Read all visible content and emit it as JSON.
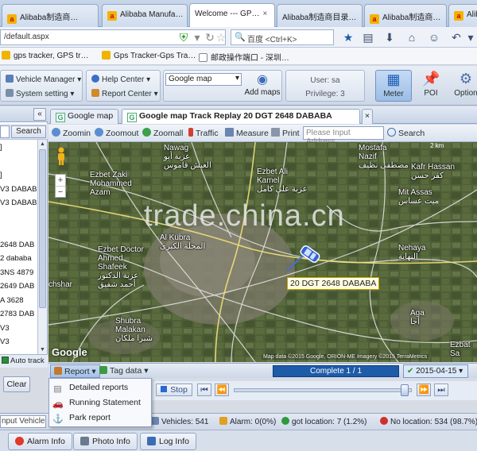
{
  "browser": {
    "tabs": [
      {
        "label": "Alibaba制造商…",
        "active": false
      },
      {
        "label": "Alibaba Manufa…",
        "active": false
      },
      {
        "label": "Welcome --- GP…",
        "active": true
      },
      {
        "label": "Alibaba制造商目录…",
        "active": false
      },
      {
        "label": "Alibaba制造商…",
        "active": false
      },
      {
        "label": "Alib",
        "active": false
      }
    ],
    "address": "/default.aspx",
    "search_engine": "百度",
    "search_hint": "<Ctrl+K>",
    "bookmarks": [
      "gps tracker, GPS tr…",
      "Gps Tracker-Gps Tra…",
      "邮政操作端口 - 深圳…"
    ]
  },
  "toolbar": {
    "vehicle_manager": "Vehicle Manager",
    "system_setting": "System setting",
    "help_center": "Help Center",
    "report_center": "Report Center",
    "map_type": "Google map",
    "add_maps": "Add maps",
    "user": "User: sa",
    "privilege": "Privilege: 3",
    "meter": "Meter",
    "poi": "POI",
    "option": "Option"
  },
  "left_panel": {
    "search_label": "Search",
    "vehicles": [
      "]",
      "",
      "]",
      "V3 DABAB",
      "V3 DABAB",
      "",
      "",
      "2648 DAB",
      "2 dababa",
      "3NS 4879",
      "2649 DAB",
      "A 3628",
      "2783 DAB",
      "V3",
      "V3"
    ],
    "auto_track": "Auto track",
    "clear": "Clear"
  },
  "map_tabs": [
    {
      "label": "Google map",
      "active": false
    },
    {
      "label": "Google map Track Replay 20 DGT 2648 DABABA",
      "active": true
    }
  ],
  "map_toolbar": {
    "zoom_in": "Zoomin",
    "zoom_out": "Zoomout",
    "zoom_all": "Zoomall",
    "traffic": "Traffic",
    "measure": "Measure",
    "print": "Print",
    "address_placeholder": "Please Input Address",
    "search": "Search"
  },
  "map": {
    "watermark": "trade.china.cn",
    "car_label": "20 DGT 2648 DABABA",
    "copyright": "Map data ©2015 Google, ORION-ME Imagery ©2015 TerraMetrics",
    "google": "Google",
    "scale": "2 km",
    "places": [
      {
        "text": "Nawag\nعزبة أبو\nالعيش قاموس"
      },
      {
        "text": "Mostafa\nNazif\nمصطفى نظيف"
      },
      {
        "text": "Ezbet Ali\nKamel\nعزبة علي كامل"
      },
      {
        "text": "Ezbet Zaki\nMohammed\nAzam"
      },
      {
        "text": "Kafr Hassan\nكفر حسن"
      },
      {
        "text": "Mit Assas\nميت عساس"
      },
      {
        "text": "Al Kubra\nالمحلة الكبرى"
      },
      {
        "text": "Ezbet Doctor\nAhmed\nShafeek\nعزبة الدكتور\nأحمد شفيق"
      },
      {
        "text": "Nehaya\nالنهاية"
      },
      {
        "text": "Shubra\nMalakan\nشبرا ملكان"
      },
      {
        "text": "Aga\nأجا"
      },
      {
        "text": "Ezbat\nSa"
      },
      {
        "text": "chshar"
      }
    ]
  },
  "report_bar": {
    "report": "Report",
    "tag_data": "Tag data",
    "progress": "Complete 1 / 1",
    "progress_value": 1.0,
    "date": "2015-04-15"
  },
  "report_menu": [
    "Detailed reports",
    "Running Statement",
    "Park report"
  ],
  "playback": {
    "stop": "Stop",
    "slider_value": 0.96
  },
  "status_bar": {
    "input_label": "nput Vehicle Li",
    "vehicles": "Vehicles: 541",
    "alarm": "Alarm: 0(0%)",
    "got_location": "got location: 7 (1.2%)",
    "no_location": "No location: 534 (98.7%)"
  },
  "bottom_tabs": [
    "Alarm Info",
    "Photo Info",
    "Log Info"
  ],
  "colors": {
    "accent": "#1e5ba8",
    "map_green": "#4a5a36"
  }
}
